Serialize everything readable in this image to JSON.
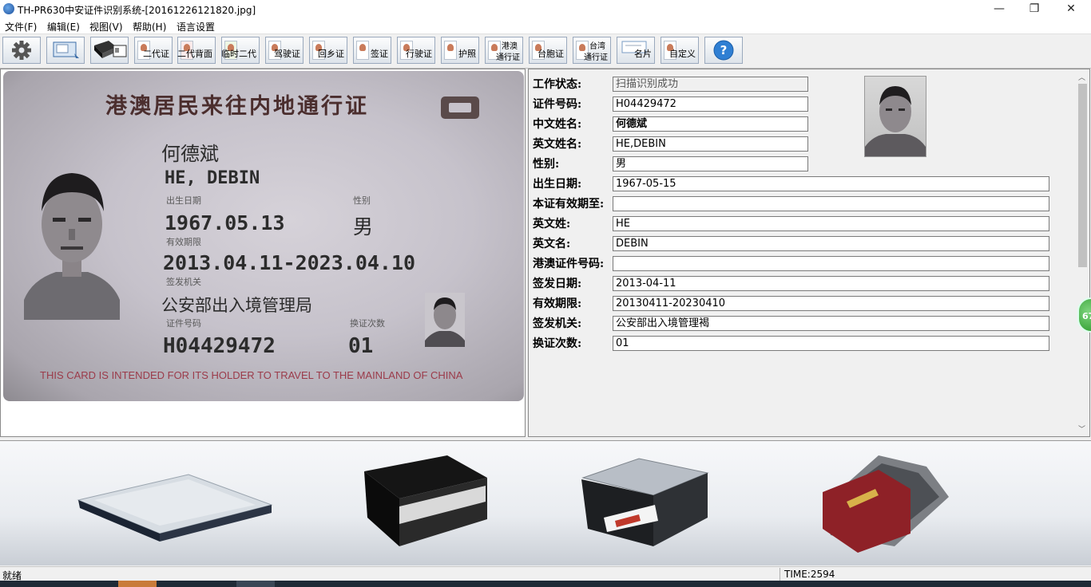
{
  "window": {
    "title": "TH-PR630中安证件识别系统-[20161226121820.jpg]",
    "controls": {
      "minimize": "—",
      "maximize": "❐",
      "close": "✕"
    }
  },
  "menu": [
    "文件(F)",
    "编辑(E)",
    "视图(V)",
    "帮助(H)",
    "语言设置"
  ],
  "toolbar": {
    "buttons": [
      {
        "name": "settings-button",
        "icon": "gear-icon"
      },
      {
        "name": "scan-button",
        "icon": "scanner-icon"
      },
      {
        "name": "reader-button",
        "icon": "card-reader-icon"
      },
      {
        "name": "id2-button",
        "label": "二代证"
      },
      {
        "name": "id2-back-button",
        "label": "二代背面"
      },
      {
        "name": "temp-id-button",
        "label": "临时二代"
      },
      {
        "name": "driver-license-button",
        "label": "驾驶证"
      },
      {
        "name": "home-return-permit-button",
        "label": "回乡证"
      },
      {
        "name": "visa-button",
        "label": "签证"
      },
      {
        "name": "vehicle-license-button",
        "label": "行驶证"
      },
      {
        "name": "passport-button",
        "label": "护照"
      },
      {
        "name": "hk-macau-pass-button",
        "top": "港澳",
        "label": "通行证"
      },
      {
        "name": "taiwan-compatriot-button",
        "label": "台胞证"
      },
      {
        "name": "taiwan-pass-button",
        "top": "台湾",
        "label": "通行证"
      },
      {
        "name": "business-card-button",
        "label": "名片"
      },
      {
        "name": "custom-button",
        "label": "自定义"
      },
      {
        "name": "help-button",
        "icon": "question-icon"
      }
    ]
  },
  "card_image": {
    "title": "港澳居民来往内地通行证",
    "name_cn": "何德斌",
    "name_en": "HE, DEBIN",
    "birth_label": "出生日期",
    "sex_label": "性别",
    "birth": "1967.05.13",
    "sex": "男",
    "validity_label": "有效期限",
    "validity": "2013.04.11-2023.04.10",
    "authority_label": "签发机关",
    "authority": "公安部出入境管理局",
    "number_label": "证件号码",
    "times_label": "换证次数",
    "number": "H04429472",
    "times": "01",
    "footer": "THIS CARD IS INTENDED FOR ITS HOLDER TO TRAVEL TO THE MAINLAND OF CHINA"
  },
  "form": {
    "fields": [
      {
        "label": "工作状态:",
        "value": "扫描识别成功"
      },
      {
        "label": "证件号码:",
        "value": "H04429472"
      },
      {
        "label": "中文姓名:",
        "value": "何德斌"
      },
      {
        "label": "英文姓名:",
        "value": "HE,DEBIN"
      },
      {
        "label": "性别:",
        "value": "男"
      },
      {
        "label": "出生日期:",
        "value": "1967-05-15"
      },
      {
        "label": "本证有效期至:",
        "value": ""
      },
      {
        "label": "英文姓:",
        "value": "HE"
      },
      {
        "label": "英文名:",
        "value": "DEBIN"
      },
      {
        "label": "港澳证件号码:",
        "value": ""
      },
      {
        "label": "签发日期:",
        "value": "2013-04-11"
      },
      {
        "label": "有效期限:",
        "value": "20130411-20230410"
      },
      {
        "label": "签发机关:",
        "value": "公安部出入境管理褐"
      },
      {
        "label": "换证次数:",
        "value": "01"
      }
    ],
    "scroll_arrows": {
      "up": "︿",
      "down": "﹀"
    }
  },
  "side_badge": "67",
  "status": {
    "ready": "就绪",
    "time": "TIME:2594"
  }
}
